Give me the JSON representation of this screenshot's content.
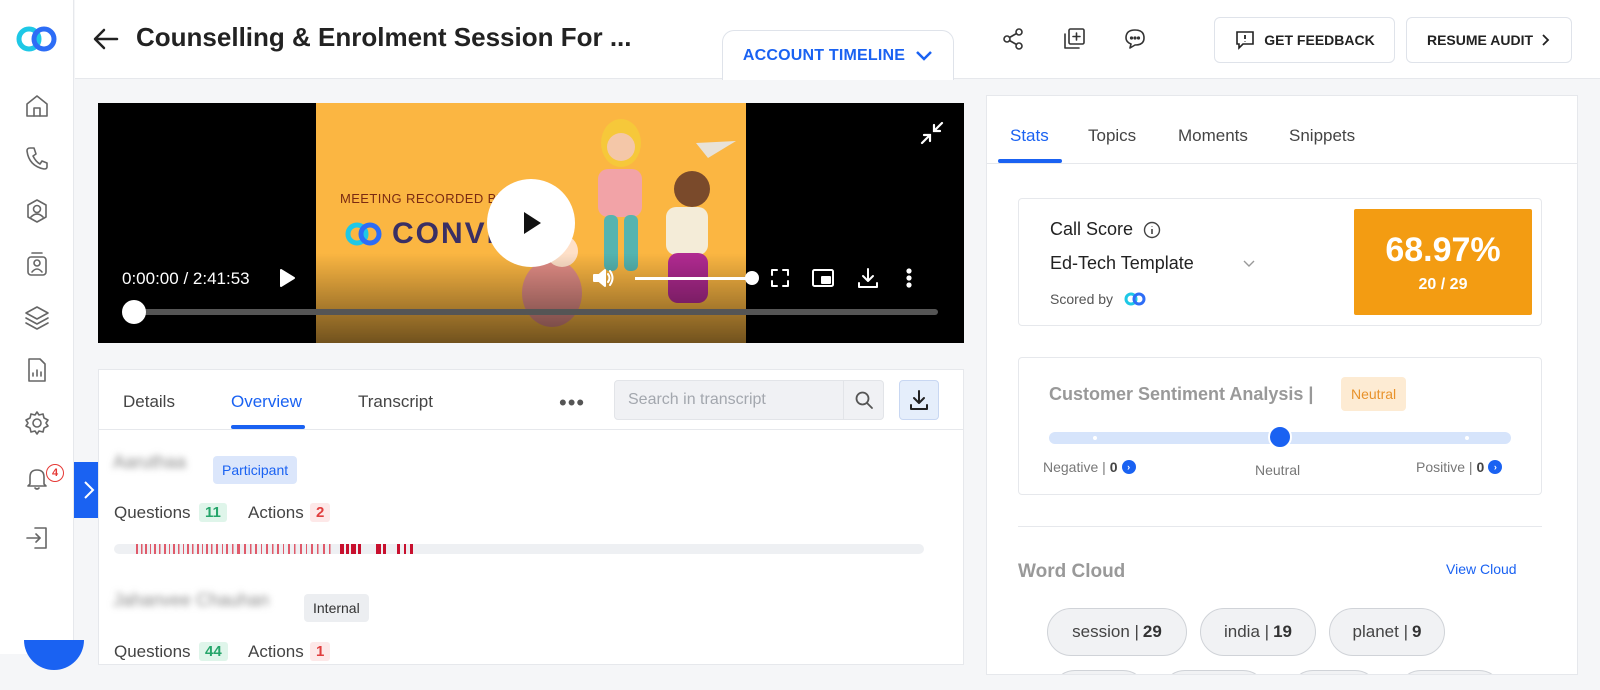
{
  "header": {
    "title": "Counselling & Enrolment Session For ...",
    "account_timeline": "ACCOUNT TIMELINE",
    "get_feedback": "GET FEEDBACK",
    "resume_audit": "RESUME AUDIT"
  },
  "sidebar": {
    "items": [
      "home-icon",
      "phone-icon",
      "team-icon",
      "agent-icon",
      "layers-icon",
      "report-icon",
      "settings-icon",
      "bell-icon",
      "logout-icon"
    ],
    "notification_count": "4"
  },
  "video": {
    "recorded_by": "MEETING RECORDED BY",
    "brand": "CONVIN",
    "time": "0:00:00 / 2:41:53",
    "progress": 0,
    "volume": 1.0
  },
  "left_tabs": [
    {
      "label": "Details"
    },
    {
      "label": "Overview"
    },
    {
      "label": "Transcript"
    }
  ],
  "active_left_tab": "Overview",
  "search": {
    "placeholder": "Search in transcript",
    "value": ""
  },
  "participants": [
    {
      "name": "Aaruthaa",
      "role": "Participant",
      "questions_label": "Questions",
      "questions": "11",
      "actions_label": "Actions",
      "actions": "2"
    },
    {
      "name": "Jahanvee Chauhan",
      "role": "Internal",
      "questions_label": "Questions",
      "questions": "44",
      "actions_label": "Actions",
      "actions": "1"
    }
  ],
  "right_tabs": [
    {
      "label": "Stats"
    },
    {
      "label": "Topics"
    },
    {
      "label": "Moments"
    },
    {
      "label": "Snippets"
    }
  ],
  "active_right_tab": "Stats",
  "call_score": {
    "label": "Call Score",
    "template": "Ed-Tech Template",
    "scored_by": "Scored by",
    "percent": "68.97%",
    "fraction": "20 / 29"
  },
  "sentiment": {
    "title": "Customer Sentiment Analysis |",
    "badge": "Neutral",
    "negative_label": "Negative |",
    "negative_count": "0",
    "neutral_label": "Neutral",
    "positive_label": "Positive |",
    "positive_count": "0",
    "position": 0.5
  },
  "word_cloud": {
    "title": "Word Cloud",
    "view_link": "View Cloud",
    "words": [
      {
        "word": "session |",
        "count": "29"
      },
      {
        "word": "india |",
        "count": "19"
      },
      {
        "word": "planet |",
        "count": "9"
      }
    ]
  },
  "colors": {
    "accent": "#1a62f2",
    "score": "#f39c12",
    "green": "#25a56a",
    "red": "#e03e3e"
  }
}
